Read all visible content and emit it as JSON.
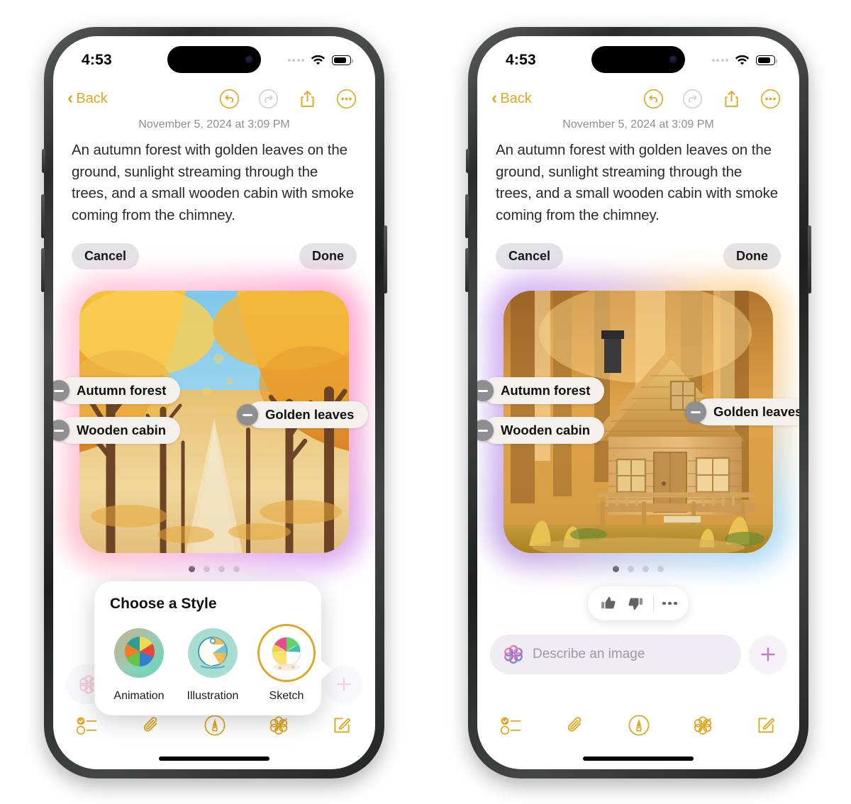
{
  "status_bar": {
    "time": "4:53",
    "wifi": "wifi-icon",
    "battery": "battery-icon",
    "signal": "signal-dots-icon"
  },
  "nav": {
    "back_label": "Back",
    "undo": "undo-icon",
    "redo": "redo-icon",
    "share": "share-icon",
    "more": "more-icon"
  },
  "note": {
    "date": "November 5, 2024 at 3:09 PM",
    "body": "An autumn forest with golden leaves on the ground, sunlight streaming through the trees, and a small wooden cabin with smoke coming from the chimney."
  },
  "actions": {
    "cancel": "Cancel",
    "done": "Done"
  },
  "concepts": [
    {
      "label": "Autumn forest"
    },
    {
      "label": "Wooden cabin"
    },
    {
      "label": "Golden leaves"
    }
  ],
  "carousel": {
    "count": 4,
    "active_index": 0
  },
  "style_picker": {
    "title": "Choose a Style",
    "options": [
      {
        "label": "Animation",
        "selected": false
      },
      {
        "label": "Illustration",
        "selected": false
      },
      {
        "label": "Sketch",
        "selected": true
      }
    ]
  },
  "feedback": {
    "thumbs_up": "thumbs-up-icon",
    "thumbs_down": "thumbs-down-icon",
    "more": "ellipsis-icon"
  },
  "describe": {
    "placeholder": "Describe an image",
    "value": "",
    "logo": "apple-intelligence-icon",
    "add": "plus-icon"
  },
  "toolbar": {
    "checklist": "checklist-icon",
    "attach": "paperclip-icon",
    "markup": "markup-pen-icon",
    "image_playground": "image-playground-icon",
    "compose": "compose-icon"
  },
  "colors": {
    "accent_gold": "#E0A725",
    "pill_gray": "#e3e3e6",
    "concept_pill": "#f4f0ec",
    "text_dark": "#2b2b2d",
    "muted": "#8e8e93"
  },
  "left_image_alt": "Autumn forest path with golden trees and blue sky",
  "right_image_alt": "Wooden cabin in a golden autumn forest"
}
